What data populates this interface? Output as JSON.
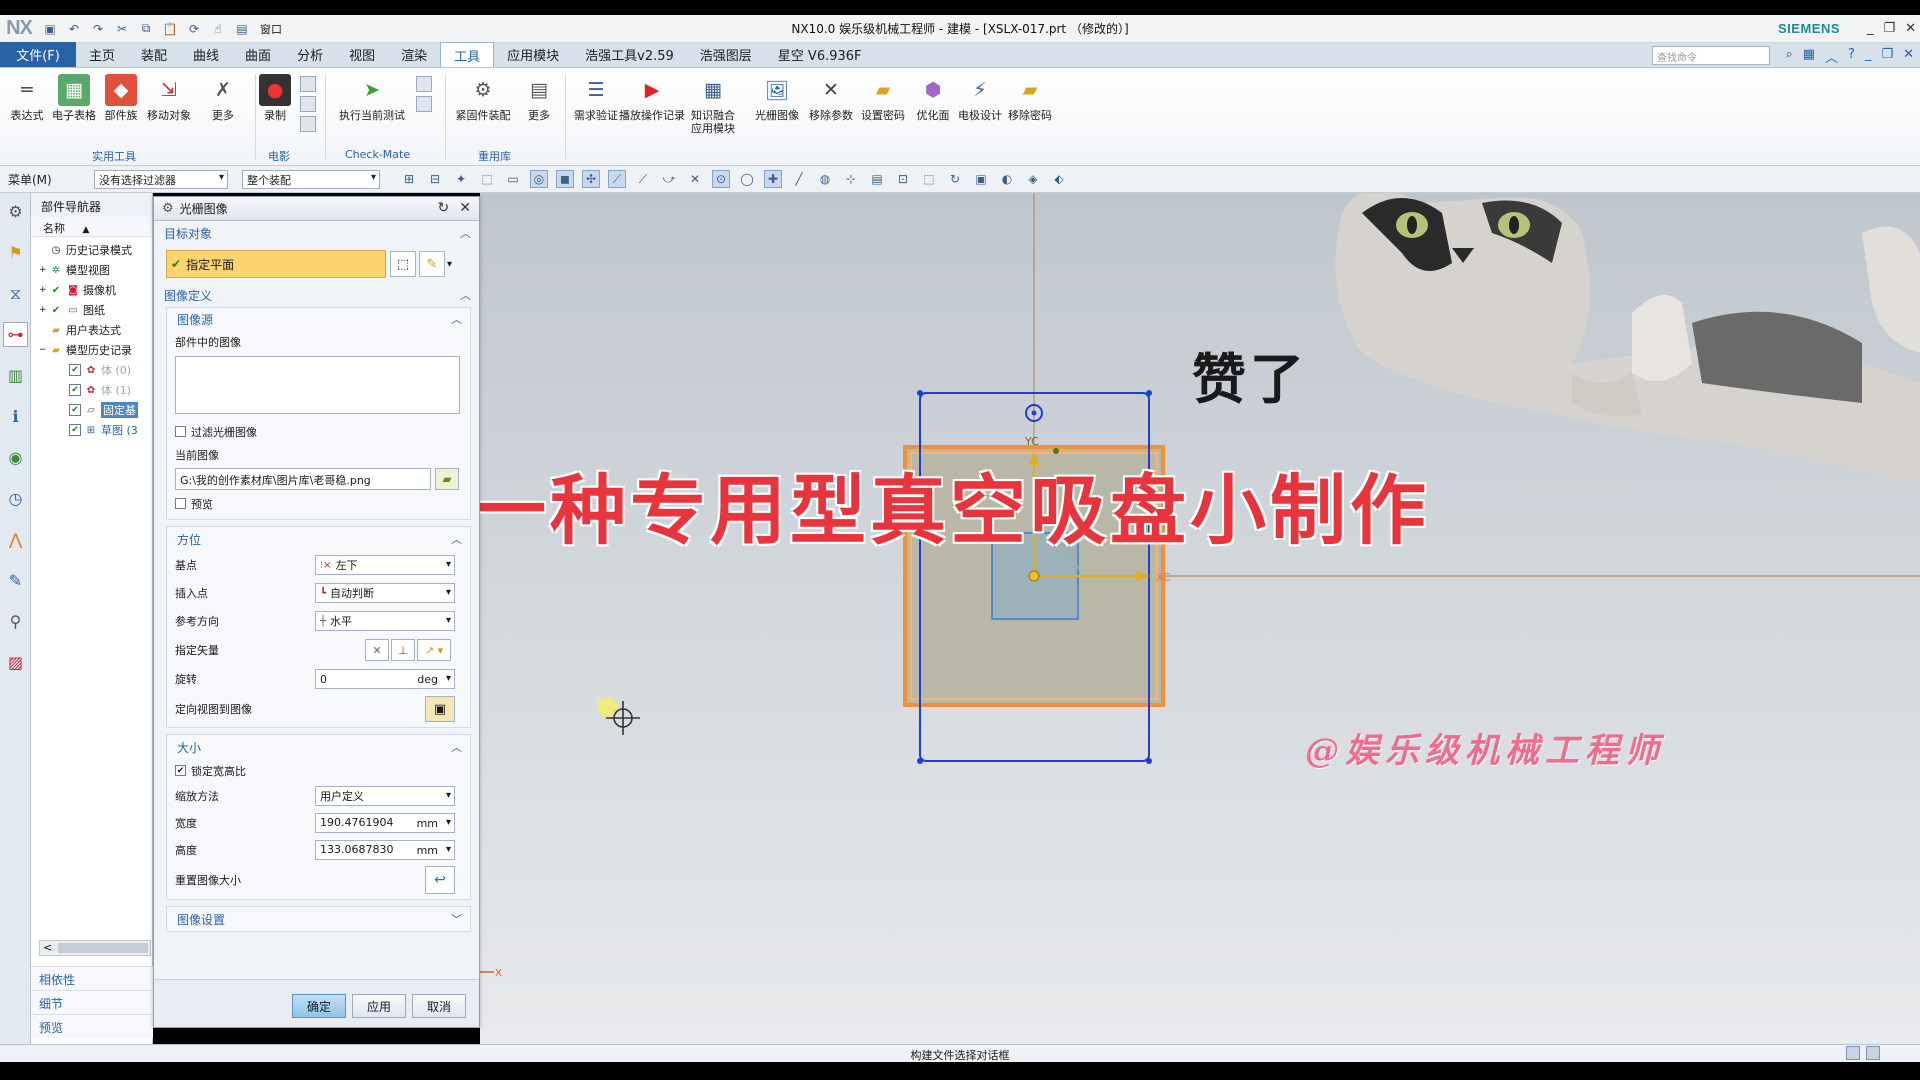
{
  "titlebar": {
    "logo": "NX",
    "window_menu": "窗口",
    "title": "NX10.0 娱乐级机械工程师 - 建模 - [XSLX-017.prt （修改的）]",
    "brand": "SIEMENS"
  },
  "menubar": {
    "file": "文件(F)",
    "tabs": [
      "主页",
      "装配",
      "曲线",
      "曲面",
      "分析",
      "视图",
      "渲染",
      "工具",
      "应用模块",
      "浩强工具v2.59",
      "浩强图层",
      "星空 V6.936F"
    ],
    "active_tab": "工具",
    "search_placeholder": "查找命令"
  },
  "ribbon": {
    "buttons": [
      {
        "label": "表达式",
        "icon": "expression-icon"
      },
      {
        "label": "电子表格",
        "icon": "spreadsheet-icon"
      },
      {
        "label": "部件族",
        "icon": "part-family-icon"
      },
      {
        "label": "移动对象",
        "icon": "move-object-icon"
      },
      {
        "label": "更多",
        "icon": "more-icon"
      },
      {
        "label": "录制",
        "icon": "record-icon"
      },
      {
        "label": "执行当前测试",
        "icon": "run-test-icon"
      },
      {
        "label": "紧固件装配",
        "icon": "fastener-icon"
      },
      {
        "label": "更多",
        "icon": "more-icon"
      },
      {
        "label": "需求验证",
        "icon": "requirement-icon"
      },
      {
        "label": "播放操作记录",
        "icon": "play-icon"
      },
      {
        "label": "知识融合应用模块",
        "icon": "knowledge-icon"
      },
      {
        "label": "光栅图像",
        "icon": "raster-image-icon"
      },
      {
        "label": "移除参数",
        "icon": "remove-params-icon"
      },
      {
        "label": "设置密码",
        "icon": "set-password-icon"
      },
      {
        "label": "优化面",
        "icon": "optimize-face-icon"
      },
      {
        "label": "电极设计",
        "icon": "electrode-icon"
      },
      {
        "label": "移除密码",
        "icon": "remove-password-icon"
      }
    ],
    "groups": [
      "实用工具",
      "电影",
      "Check-Mate",
      "重用库"
    ]
  },
  "filterbar": {
    "menu": "菜单(M)",
    "selection_filter": "没有选择过滤器",
    "scope": "整个装配"
  },
  "navigator": {
    "title": "部件导航器",
    "column": "名称",
    "items": [
      {
        "label": "历史记录模式"
      },
      {
        "label": "模型视图"
      },
      {
        "label": "摄像机"
      },
      {
        "label": "图纸"
      },
      {
        "label": "用户表达式"
      },
      {
        "label": "模型历史记录"
      },
      {
        "label": "体 (0)"
      },
      {
        "label": "体 (1)"
      },
      {
        "label": "固定基"
      },
      {
        "label": "草图 (3"
      }
    ],
    "panels": [
      "相依性",
      "细节",
      "预览"
    ]
  },
  "dialog": {
    "title": "光栅图像",
    "target_section": "目标对象",
    "target_field": "指定平面",
    "image_def_section": "图像定义",
    "image_source": "图像源",
    "images_in_part": "部件中的图像",
    "filter_raster": "过滤光栅图像",
    "current_image_label": "当前图像",
    "current_image_path": "G:\\我的创作素材库\\图片库\\老哥稳.png",
    "preview_label": "预览",
    "orientation_section": "方位",
    "base_point_label": "基点",
    "base_point_value": "左下",
    "insert_point_label": "插入点",
    "insert_point_value": "自动判断",
    "ref_dir_label": "参考方向",
    "ref_dir_value": "水平",
    "vector_label": "指定矢量",
    "rotate_label": "旋转",
    "rotate_value": "0",
    "rotate_unit": "deg",
    "orient_view_label": "定向视图到图像",
    "size_section": "大小",
    "lock_ratio_label": "锁定宽高比",
    "scale_method_label": "缩放方法",
    "scale_method_value": "用户定义",
    "width_label": "宽度",
    "width_value": "190.4761904",
    "width_unit": "mm",
    "height_label": "高度",
    "height_value": "133.0687830",
    "height_unit": "mm",
    "reset_size_label": "重置图像大小",
    "image_settings_section": "图像设置",
    "ok": "确定",
    "apply": "应用",
    "cancel": "取消"
  },
  "graphics": {
    "overlay_title": "一种专用型真空吸盘小制作",
    "caption": "赞了",
    "watermark": "@娱乐级机械工程师",
    "yc": "YC",
    "xc": "XC",
    "x_axis": "X"
  },
  "statusbar": {
    "text": "构建文件选择对话框"
  },
  "colors": {
    "accent": "#2a62a6",
    "target_field": "#fbd36f",
    "selection_orange": "#f0903a",
    "selection_blue": "#1b3fd4",
    "overlay_title_red": "#e8343c",
    "watermark_pink": "#f26a8d"
  }
}
